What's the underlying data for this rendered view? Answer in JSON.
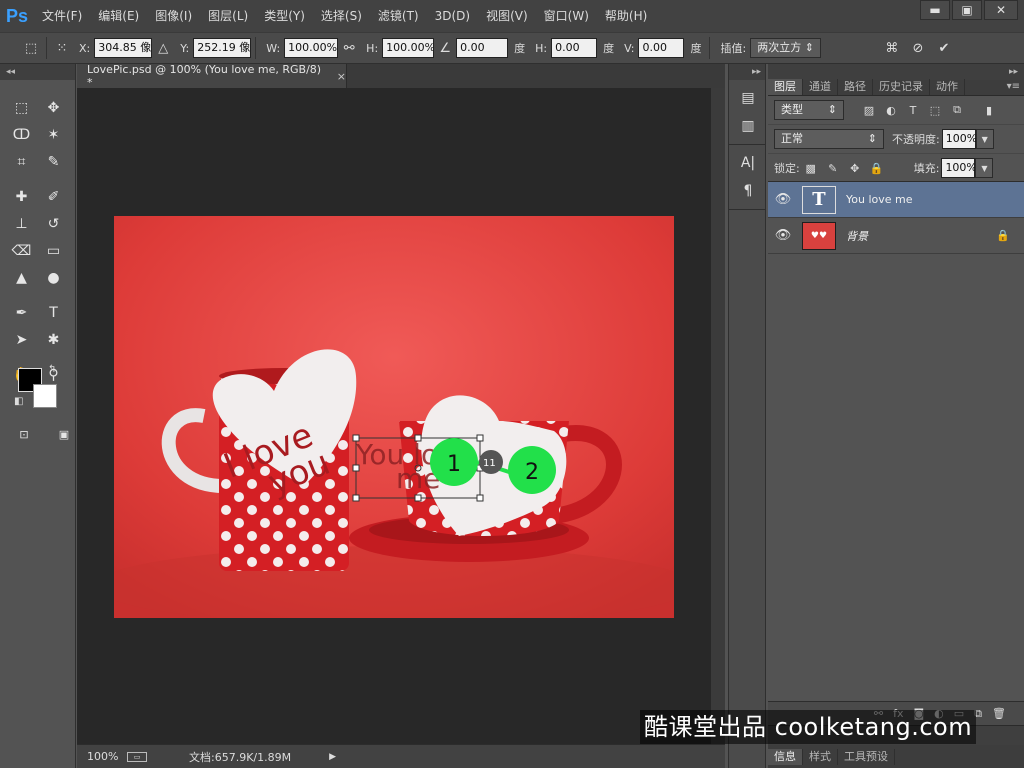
{
  "app": {
    "logo": "Ps",
    "menu": [
      "文件(F)",
      "编辑(E)",
      "图像(I)",
      "图层(L)",
      "类型(Y)",
      "选择(S)",
      "滤镜(T)",
      "3D(D)",
      "视图(V)",
      "窗口(W)",
      "帮助(H)"
    ],
    "window_buttons": [
      "▬",
      "▣",
      "✕"
    ]
  },
  "options_bar": {
    "x_label": "X:",
    "x_value": "304.85 像",
    "y_label": "Y:",
    "y_value": "252.19 像",
    "w_label": "W:",
    "w_value": "100.00%",
    "h_label": "H:",
    "h_value": "100.00%",
    "angle_value": "0.00",
    "angle_unit": "度",
    "hskew_label": "H:",
    "hskew_value": "0.00",
    "hskew_unit": "度",
    "vskew_label": "V:",
    "vskew_value": "0.00",
    "vskew_unit": "度",
    "interp_label": "插值:",
    "interp_value": "两次立方"
  },
  "document": {
    "tab_title": "LovePic.psd @ 100% (You love me, RGB/8) *",
    "tab_close": "×",
    "zoom": "100%",
    "doc_size": "文档:657.9K/1.89M",
    "left_heart_text_1": "I love",
    "left_heart_text_2": "you",
    "text_layer_preview_1": "You love",
    "text_layer_preview_2": "me",
    "marker_1": "1",
    "marker_2": "2",
    "marker_badge": "11"
  },
  "layers_panel": {
    "tabs": [
      "图层",
      "通道",
      "路径",
      "历史记录",
      "动作"
    ],
    "filter_kind": "类型",
    "blend_mode": "正常",
    "opacity_label": "不透明度:",
    "opacity_value": "100%",
    "lock_label": "锁定:",
    "fill_label": "填充:",
    "fill_value": "100%",
    "layers": [
      {
        "name": "You love me",
        "kind": "text",
        "selected": true
      },
      {
        "name": "背景",
        "kind": "image",
        "locked": true
      }
    ],
    "bottom_tabs": [
      "信息",
      "样式",
      "工具预设"
    ]
  },
  "watermark": "酷课堂出品 coolketang.com"
}
